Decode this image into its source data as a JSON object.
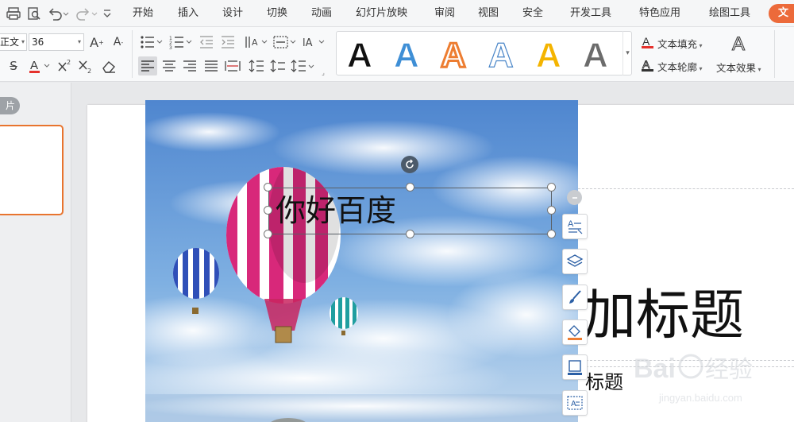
{
  "quick_access": {
    "icons": [
      "print-icon",
      "print-preview-icon",
      "undo-icon",
      "redo-icon",
      "customize-icon"
    ]
  },
  "menu": {
    "tabs": [
      "开始",
      "插入",
      "设计",
      "切换",
      "动画",
      "幻灯片放映",
      "审阅",
      "视图",
      "安全",
      "开发工具",
      "特色应用",
      "绘图工具"
    ],
    "active_tab": "文"
  },
  "ribbon": {
    "font_name": "正文",
    "font_size": "36",
    "text_fill_label": "文本填充",
    "text_outline_label": "文本轮廓",
    "text_effect_label": "文本效果",
    "style_gallery": [
      {
        "letter": "A",
        "fill": "#111111",
        "stroke": "#ffffff"
      },
      {
        "letter": "A",
        "fill": "#3f8fd6",
        "stroke": "#ffffff"
      },
      {
        "letter": "A",
        "fill": "#ffffff",
        "stroke": "#ed7d31"
      },
      {
        "letter": "A",
        "fill": "#ffffff",
        "stroke": "#4a86c8"
      },
      {
        "letter": "A",
        "fill": "#f4b400",
        "stroke": "#ffffff"
      },
      {
        "letter": "A",
        "fill": "#6c6c6c",
        "stroke": "#ffffff"
      }
    ]
  },
  "left_panel": {
    "pill_label": "片"
  },
  "slide": {
    "textbox_text": "你好百度",
    "title_text": "加标题",
    "subtitle_text": "标题"
  },
  "colors": {
    "accent": "#ec6a3a",
    "selection": "#e8742f"
  }
}
